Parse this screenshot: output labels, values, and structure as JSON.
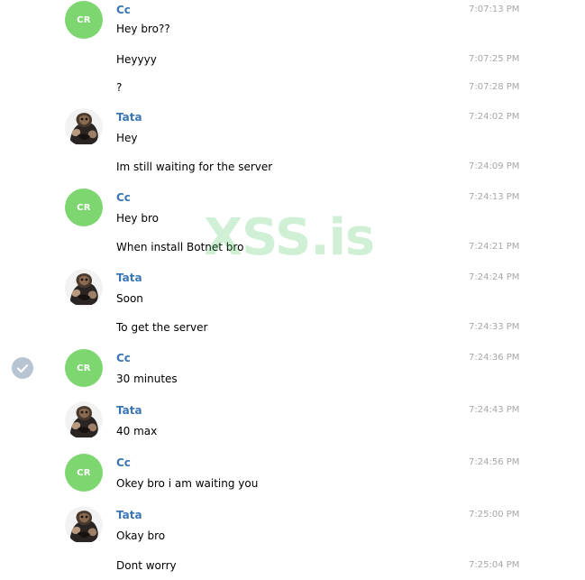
{
  "watermark": "XSS.is",
  "messages": [
    {
      "avatar": "CR",
      "sender": "Cc",
      "text": "Hey bro??",
      "time": "7:07:13 PM"
    },
    {
      "text": "Heyyyy",
      "time": "7:07:25 PM"
    },
    {
      "text": "?",
      "time": "7:07:28 PM"
    },
    {
      "avatar_icon": "user-photo-avatar",
      "sender": "Tata",
      "text": "Hey",
      "time": "7:24:02 PM"
    },
    {
      "text": "Im still waiting for the server",
      "time": "7:24:09 PM"
    },
    {
      "avatar": "CR",
      "sender": "Cc",
      "text": "Hey bro",
      "time": "7:24:13 PM"
    },
    {
      "text": "When install Botnet bro",
      "time": "7:24:21 PM"
    },
    {
      "avatar_icon": "user-photo-avatar",
      "sender": "Tata",
      "text": "Soon",
      "time": "7:24:24 PM"
    },
    {
      "text": "To get the server",
      "time": "7:24:33 PM"
    },
    {
      "avatar": "CR",
      "sender": "Cc",
      "text": "30 minutes",
      "time": "7:24:36 PM",
      "selected": true
    },
    {
      "avatar_icon": "user-photo-avatar",
      "sender": "Tata",
      "text": "40 max",
      "time": "7:24:43 PM"
    },
    {
      "avatar": "CR",
      "sender": "Cc",
      "text": "Okey bro i am waiting you",
      "time": "7:24:56 PM"
    },
    {
      "avatar_icon": "user-photo-avatar",
      "sender": "Tata",
      "text": "Okay bro",
      "time": "7:25:00 PM"
    },
    {
      "text": "Dont worry",
      "time": "7:25:04 PM"
    }
  ],
  "colors": {
    "cr_avatar": "#7dd66f",
    "sender_name": "#3a76b5",
    "timestamp": "#a7a7a7",
    "select_check": "#b7c4d2",
    "watermark": "#2fbf4a"
  }
}
